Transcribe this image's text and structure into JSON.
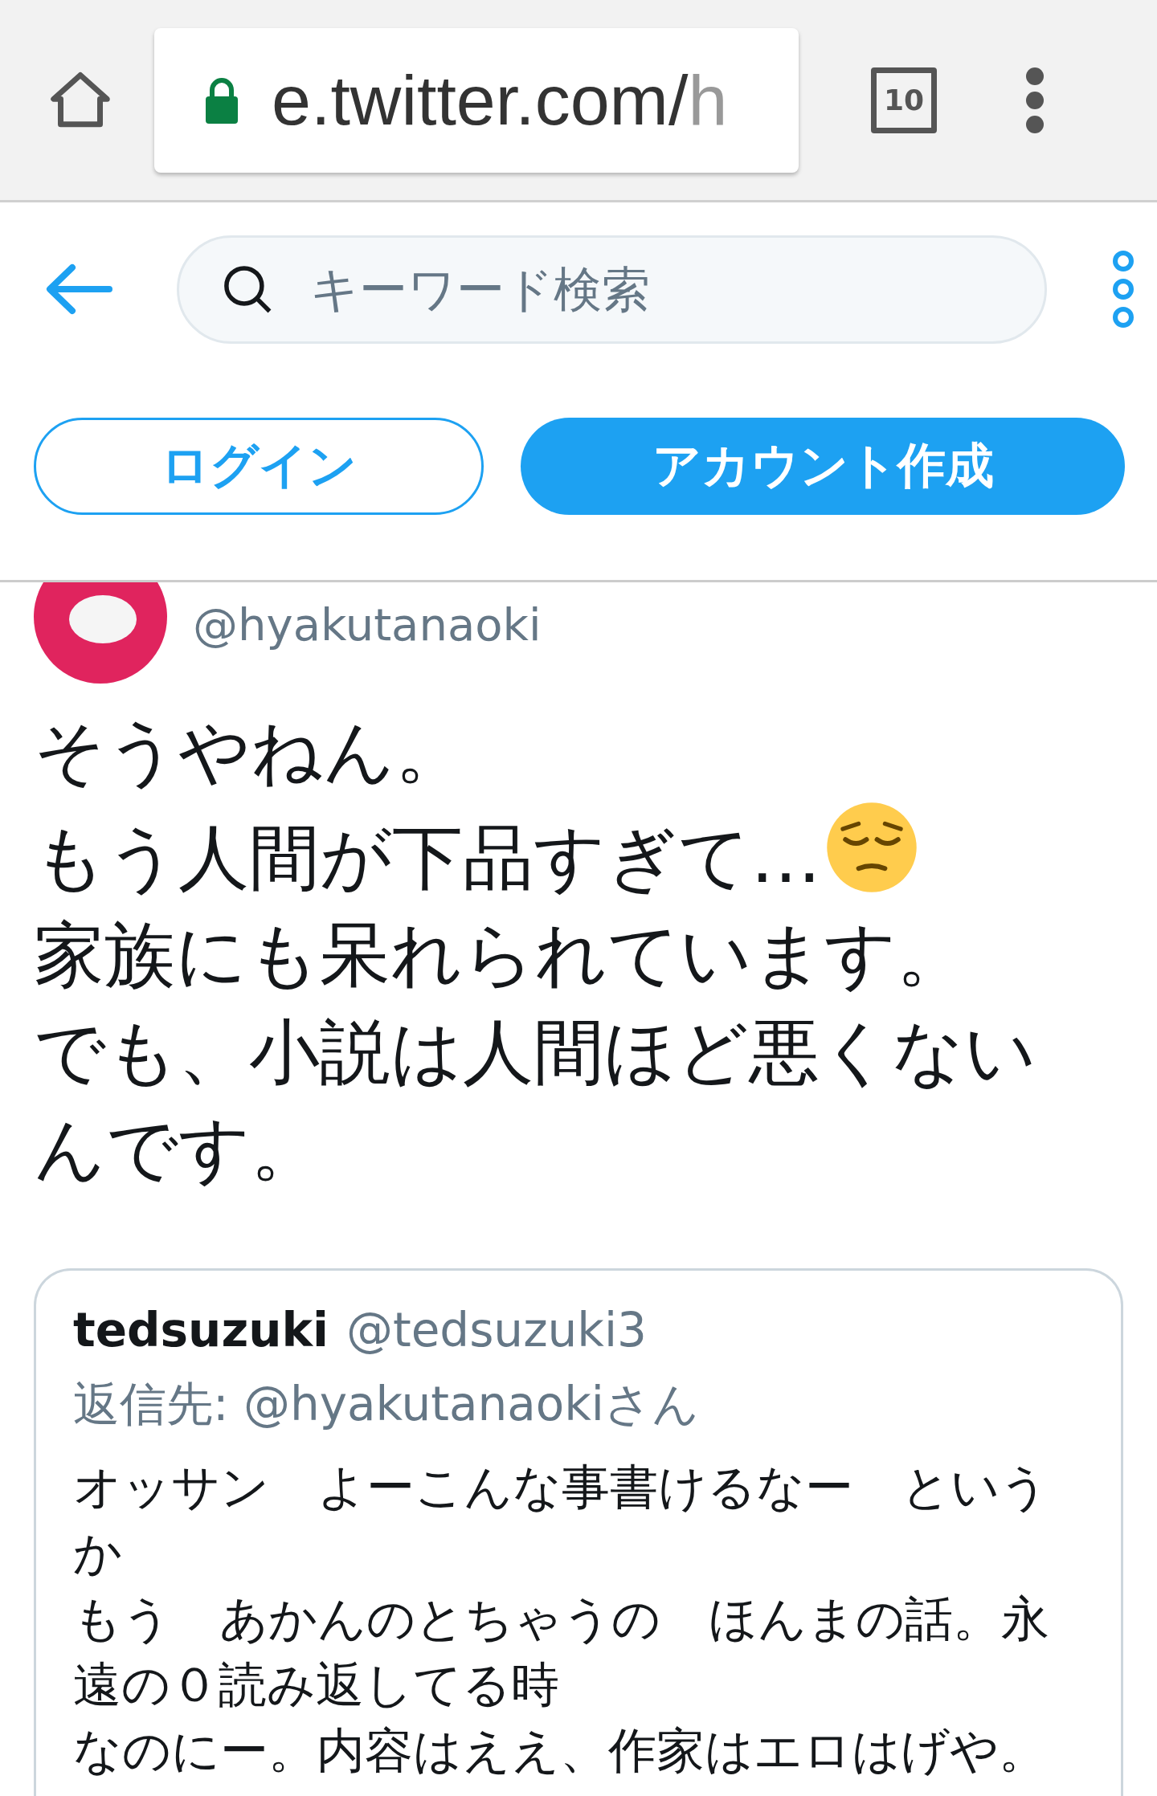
{
  "browser": {
    "url_host": "e.twitter.com/",
    "url_rest": "h",
    "tab_count": "10"
  },
  "header": {
    "search": {
      "placeholder": "キーワード検索"
    },
    "buttons": [
      {
        "label": "ログイン",
        "kind": "outline"
      },
      {
        "label": "アカウント作成",
        "kind": "filled"
      }
    ]
  },
  "tweet": {
    "handle": "@hyakutanaoki",
    "lines": [
      "そうやねん。",
      "もう人間が下品すぎて…",
      "家族にも呆れられています。",
      "でも、小説は人間ほど悪くないんです。"
    ],
    "quote": {
      "name": "tedsuzuki",
      "handle": "@tedsuzuki3",
      "reply_label": "返信先: @hyakutanaokiさん",
      "lines": [
        "オッサン　よーこんな事書けるなー　というか",
        "もう　あかんのとちゃうの　ほんまの話。永遠の０読み返してる時",
        "なのにー。内容はええ、作家はエロはげや。"
      ]
    }
  }
}
